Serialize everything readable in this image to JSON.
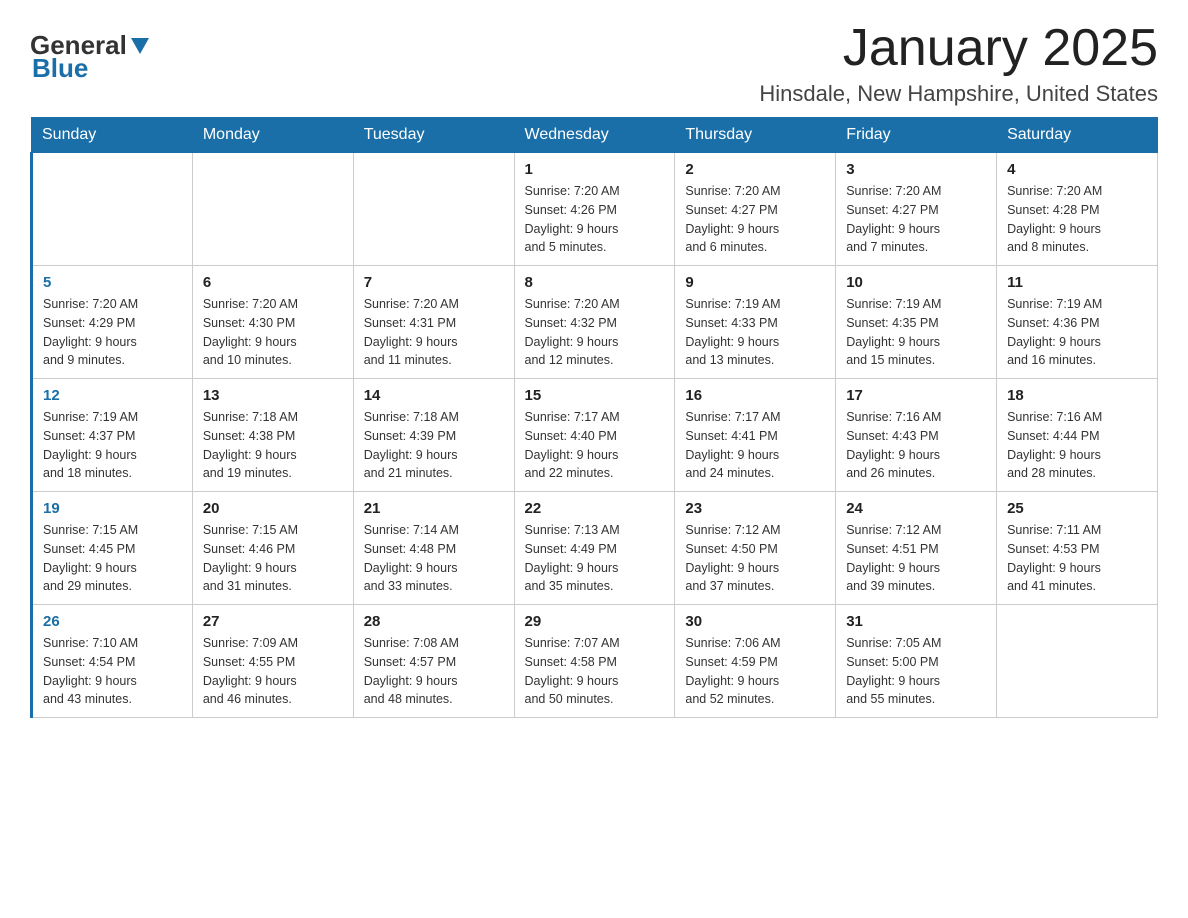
{
  "header": {
    "logo_general": "General",
    "logo_blue": "Blue",
    "month_title": "January 2025",
    "location": "Hinsdale, New Hampshire, United States"
  },
  "days_of_week": [
    "Sunday",
    "Monday",
    "Tuesday",
    "Wednesday",
    "Thursday",
    "Friday",
    "Saturday"
  ],
  "weeks": [
    [
      {
        "day": "",
        "info": ""
      },
      {
        "day": "",
        "info": ""
      },
      {
        "day": "",
        "info": ""
      },
      {
        "day": "1",
        "info": "Sunrise: 7:20 AM\nSunset: 4:26 PM\nDaylight: 9 hours\nand 5 minutes."
      },
      {
        "day": "2",
        "info": "Sunrise: 7:20 AM\nSunset: 4:27 PM\nDaylight: 9 hours\nand 6 minutes."
      },
      {
        "day": "3",
        "info": "Sunrise: 7:20 AM\nSunset: 4:27 PM\nDaylight: 9 hours\nand 7 minutes."
      },
      {
        "day": "4",
        "info": "Sunrise: 7:20 AM\nSunset: 4:28 PM\nDaylight: 9 hours\nand 8 minutes."
      }
    ],
    [
      {
        "day": "5",
        "info": "Sunrise: 7:20 AM\nSunset: 4:29 PM\nDaylight: 9 hours\nand 9 minutes."
      },
      {
        "day": "6",
        "info": "Sunrise: 7:20 AM\nSunset: 4:30 PM\nDaylight: 9 hours\nand 10 minutes."
      },
      {
        "day": "7",
        "info": "Sunrise: 7:20 AM\nSunset: 4:31 PM\nDaylight: 9 hours\nand 11 minutes."
      },
      {
        "day": "8",
        "info": "Sunrise: 7:20 AM\nSunset: 4:32 PM\nDaylight: 9 hours\nand 12 minutes."
      },
      {
        "day": "9",
        "info": "Sunrise: 7:19 AM\nSunset: 4:33 PM\nDaylight: 9 hours\nand 13 minutes."
      },
      {
        "day": "10",
        "info": "Sunrise: 7:19 AM\nSunset: 4:35 PM\nDaylight: 9 hours\nand 15 minutes."
      },
      {
        "day": "11",
        "info": "Sunrise: 7:19 AM\nSunset: 4:36 PM\nDaylight: 9 hours\nand 16 minutes."
      }
    ],
    [
      {
        "day": "12",
        "info": "Sunrise: 7:19 AM\nSunset: 4:37 PM\nDaylight: 9 hours\nand 18 minutes."
      },
      {
        "day": "13",
        "info": "Sunrise: 7:18 AM\nSunset: 4:38 PM\nDaylight: 9 hours\nand 19 minutes."
      },
      {
        "day": "14",
        "info": "Sunrise: 7:18 AM\nSunset: 4:39 PM\nDaylight: 9 hours\nand 21 minutes."
      },
      {
        "day": "15",
        "info": "Sunrise: 7:17 AM\nSunset: 4:40 PM\nDaylight: 9 hours\nand 22 minutes."
      },
      {
        "day": "16",
        "info": "Sunrise: 7:17 AM\nSunset: 4:41 PM\nDaylight: 9 hours\nand 24 minutes."
      },
      {
        "day": "17",
        "info": "Sunrise: 7:16 AM\nSunset: 4:43 PM\nDaylight: 9 hours\nand 26 minutes."
      },
      {
        "day": "18",
        "info": "Sunrise: 7:16 AM\nSunset: 4:44 PM\nDaylight: 9 hours\nand 28 minutes."
      }
    ],
    [
      {
        "day": "19",
        "info": "Sunrise: 7:15 AM\nSunset: 4:45 PM\nDaylight: 9 hours\nand 29 minutes."
      },
      {
        "day": "20",
        "info": "Sunrise: 7:15 AM\nSunset: 4:46 PM\nDaylight: 9 hours\nand 31 minutes."
      },
      {
        "day": "21",
        "info": "Sunrise: 7:14 AM\nSunset: 4:48 PM\nDaylight: 9 hours\nand 33 minutes."
      },
      {
        "day": "22",
        "info": "Sunrise: 7:13 AM\nSunset: 4:49 PM\nDaylight: 9 hours\nand 35 minutes."
      },
      {
        "day": "23",
        "info": "Sunrise: 7:12 AM\nSunset: 4:50 PM\nDaylight: 9 hours\nand 37 minutes."
      },
      {
        "day": "24",
        "info": "Sunrise: 7:12 AM\nSunset: 4:51 PM\nDaylight: 9 hours\nand 39 minutes."
      },
      {
        "day": "25",
        "info": "Sunrise: 7:11 AM\nSunset: 4:53 PM\nDaylight: 9 hours\nand 41 minutes."
      }
    ],
    [
      {
        "day": "26",
        "info": "Sunrise: 7:10 AM\nSunset: 4:54 PM\nDaylight: 9 hours\nand 43 minutes."
      },
      {
        "day": "27",
        "info": "Sunrise: 7:09 AM\nSunset: 4:55 PM\nDaylight: 9 hours\nand 46 minutes."
      },
      {
        "day": "28",
        "info": "Sunrise: 7:08 AM\nSunset: 4:57 PM\nDaylight: 9 hours\nand 48 minutes."
      },
      {
        "day": "29",
        "info": "Sunrise: 7:07 AM\nSunset: 4:58 PM\nDaylight: 9 hours\nand 50 minutes."
      },
      {
        "day": "30",
        "info": "Sunrise: 7:06 AM\nSunset: 4:59 PM\nDaylight: 9 hours\nand 52 minutes."
      },
      {
        "day": "31",
        "info": "Sunrise: 7:05 AM\nSunset: 5:00 PM\nDaylight: 9 hours\nand 55 minutes."
      },
      {
        "day": "",
        "info": ""
      }
    ]
  ]
}
